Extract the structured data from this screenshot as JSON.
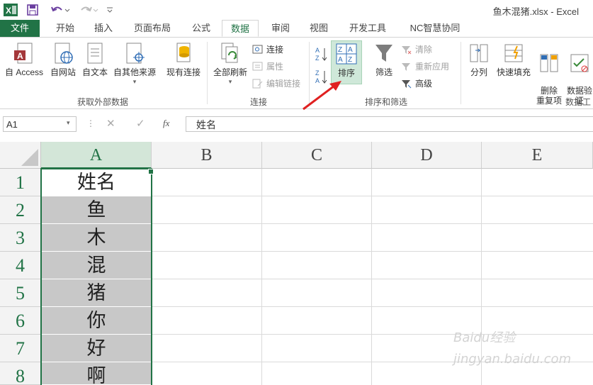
{
  "window": {
    "title": "鱼木混猪.xlsx - Excel",
    "qat": {
      "save_icon": "save-icon",
      "undo_icon": "undo-icon",
      "redo_icon": "redo-icon"
    }
  },
  "tabs": [
    {
      "label": "文件"
    },
    {
      "label": "开始"
    },
    {
      "label": "插入"
    },
    {
      "label": "页面布局"
    },
    {
      "label": "公式"
    },
    {
      "label": "数据"
    },
    {
      "label": "审阅"
    },
    {
      "label": "视图"
    },
    {
      "label": "开发工具"
    },
    {
      "label": "NC智慧协同"
    }
  ],
  "ribbon": {
    "external": {
      "access": "自 Access",
      "web": "自网站",
      "text": "自文本",
      "other": "自其他来源",
      "existing": "现有连接",
      "group": "获取外部数据"
    },
    "connections": {
      "refresh_all": "全部刷新",
      "connections": "连接",
      "properties": "属性",
      "edit_links": "编辑链接",
      "group": "连接"
    },
    "sort_filter": {
      "sort_az_icon": "sort-az-icon",
      "sort_za_icon": "sort-za-icon",
      "sort": "排序",
      "filter": "筛选",
      "clear": "清除",
      "reapply": "重新应用",
      "advanced": "高级",
      "group": "排序和筛选"
    },
    "tools": {
      "split": "分列",
      "flash_fill": "快速填充",
      "remove_dup": "删除\n重复项",
      "validate": "数据验\n证",
      "group": "数据工"
    }
  },
  "formula_bar": {
    "name_box": "A1",
    "fx": "fx",
    "content": "姓名"
  },
  "grid": {
    "columns": [
      "A",
      "B",
      "C",
      "D",
      "E"
    ],
    "rows": [
      "1",
      "2",
      "3",
      "4",
      "5",
      "6",
      "7",
      "8"
    ],
    "col_a_values": [
      "姓名",
      "鱼",
      "木",
      "混",
      "猪",
      "你",
      "好",
      "啊"
    ]
  },
  "colors": {
    "excel_green": "#217346",
    "selection_shade": "#c8c8c8",
    "arrow": "#e02020"
  },
  "watermark": "Baidu经验 jingyan.baidu.com"
}
